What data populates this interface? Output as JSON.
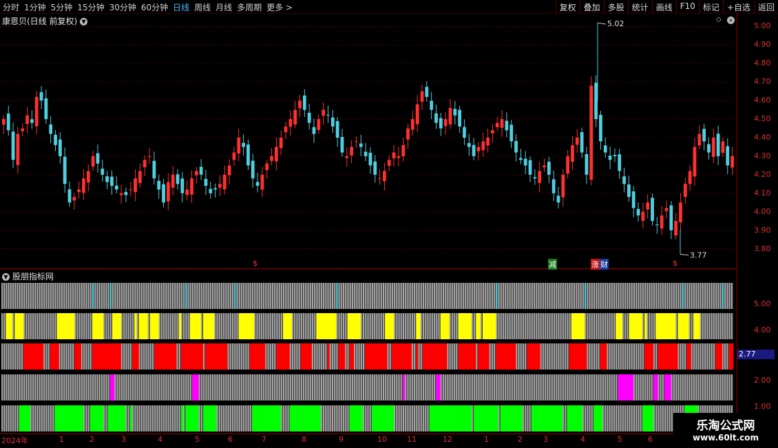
{
  "toolbar": {
    "periods": [
      "分时",
      "1分钟",
      "5分钟",
      "15分钟",
      "30分钟",
      "60分钟",
      "日线",
      "周线",
      "月线",
      "多周期",
      "更多 >"
    ],
    "active_period": "日线",
    "actions": [
      "复权",
      "叠加",
      "多股",
      "统计",
      "画线",
      "F10",
      "标记",
      "+自选",
      "返回"
    ]
  },
  "main_chart": {
    "title": "康恩贝(日线 前复权)",
    "high_label": "5.02",
    "low_label": "3.77",
    "price_axis": [
      "5.00",
      "4.90",
      "4.80",
      "4.70",
      "4.60",
      "4.50",
      "4.40",
      "4.30",
      "4.20",
      "4.10",
      "4.00",
      "3.90",
      "3.80"
    ],
    "markers": [
      {
        "text": "$",
        "color": "#ff3030",
        "bg": "transparent"
      },
      {
        "text": "减",
        "color": "#fff",
        "bg": "#1a7a1a"
      },
      {
        "text": "涨",
        "color": "#fff",
        "bg": "#c01010"
      },
      {
        "text": "财",
        "color": "#fff",
        "bg": "#1a3a9a"
      },
      {
        "text": "$",
        "color": "#ff3030",
        "bg": "transparent"
      }
    ]
  },
  "indicator_panel": {
    "title": "股朋指标网",
    "axis": [
      "5.00",
      "4.00",
      "2.77",
      "2.00",
      "1.00"
    ],
    "current_value": "2.77"
  },
  "date_axis": [
    "2024年",
    "1",
    "2",
    "3",
    "4",
    "5",
    "6",
    "7",
    "8",
    "9",
    "10",
    "11",
    "12",
    "1",
    "2",
    "3",
    "4",
    "5",
    "6"
  ],
  "watermark": {
    "title": "乐淘公式网",
    "url": "www.60lt.com"
  },
  "colors": {
    "up": "#ff3030",
    "down": "#4fd0e0",
    "axis": "#e03030",
    "grid": "#7a0000"
  },
  "chart_data": {
    "type": "candlestick",
    "ylim": [
      3.75,
      5.05
    ],
    "high": 5.02,
    "low": 3.77,
    "closes": [
      4.5,
      4.44,
      4.28,
      4.42,
      4.45,
      4.52,
      4.48,
      4.62,
      4.6,
      4.5,
      4.42,
      4.36,
      4.3,
      4.15,
      4.05,
      4.08,
      4.12,
      4.18,
      4.22,
      4.3,
      4.26,
      4.2,
      4.16,
      4.14,
      4.12,
      4.1,
      4.09,
      4.12,
      4.18,
      4.22,
      4.28,
      4.3,
      4.18,
      4.12,
      4.05,
      4.16,
      4.2,
      4.15,
      4.1,
      4.12,
      4.18,
      4.22,
      4.2,
      4.14,
      4.1,
      4.12,
      4.15,
      4.2,
      4.25,
      4.32,
      4.4,
      4.35,
      4.25,
      4.18,
      4.14,
      4.2,
      4.26,
      4.3,
      4.35,
      4.4,
      4.46,
      4.5,
      4.55,
      4.6,
      4.55,
      4.48,
      4.42,
      4.5,
      4.55,
      4.52,
      4.46,
      4.4,
      4.32,
      4.3,
      4.35,
      4.38,
      4.35,
      4.3,
      4.25,
      4.2,
      4.18,
      4.22,
      4.28,
      4.32,
      4.3,
      4.36,
      4.45,
      4.5,
      4.58,
      4.65,
      4.62,
      4.55,
      4.48,
      4.45,
      4.5,
      4.56,
      4.52,
      4.46,
      4.4,
      4.35,
      4.3,
      4.35,
      4.38,
      4.4,
      4.44,
      4.48,
      4.5,
      4.44,
      4.38,
      4.32,
      4.28,
      4.25,
      4.2,
      4.18,
      4.22,
      4.25,
      4.2,
      4.1,
      4.05,
      4.2,
      4.3,
      4.36,
      4.4,
      4.32,
      4.2,
      4.68,
      4.5,
      4.38,
      4.32,
      4.28,
      4.3,
      4.22,
      4.15,
      4.08,
      4.02,
      3.98,
      4.0,
      4.05,
      3.95,
      3.93,
      3.98,
      4.02,
      3.9,
      3.95,
      4.05,
      4.15,
      4.22,
      4.35,
      4.42,
      4.38,
      4.32,
      4.4,
      4.3,
      4.38,
      4.25,
      4.3
    ]
  },
  "indicator_data": {
    "row_colors": [
      "#40e0f0",
      "#ffff00",
      "#ff0000",
      "#ff00ff",
      "#00ff00"
    ]
  }
}
